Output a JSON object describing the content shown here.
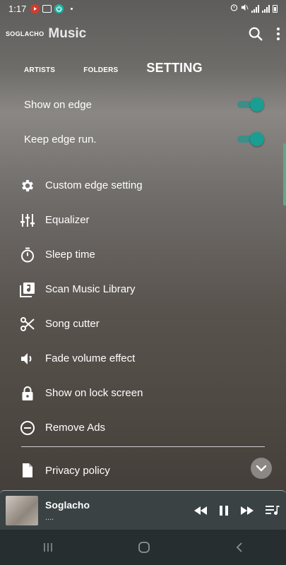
{
  "status": {
    "time": "1:17",
    "app_icons": [
      "youtube-icon",
      "gallery-icon",
      "power-icon"
    ],
    "colors": {
      "youtube": "#d33b2c",
      "gallery": "#ffffff",
      "power": "#1fb5a6"
    }
  },
  "header": {
    "brand_small": "SOGLACHO",
    "brand_big": "Music"
  },
  "tabs": [
    {
      "label": "ARTISTS",
      "active": false
    },
    {
      "label": "FOLDERS",
      "active": false
    },
    {
      "label": "SETTING",
      "active": true
    }
  ],
  "toggles": [
    {
      "label": "Show on edge",
      "on": true
    },
    {
      "label": "Keep edge run.",
      "on": true
    }
  ],
  "menu": [
    {
      "label": "Custom edge setting",
      "icon": "gear-icon"
    },
    {
      "label": "Equalizer",
      "icon": "equalizer-icon"
    },
    {
      "label": "Sleep time",
      "icon": "timer-icon"
    },
    {
      "label": "Scan Music Library",
      "icon": "music-library-icon"
    },
    {
      "label": "Song cutter",
      "icon": "scissors-icon"
    },
    {
      "label": "Fade volume effect",
      "icon": "volume-icon"
    },
    {
      "label": "Show on lock screen",
      "icon": "lock-icon"
    },
    {
      "label": "Remove Ads",
      "icon": "remove-icon"
    }
  ],
  "privacy": {
    "label": "Privacy policy",
    "icon": "document-icon"
  },
  "player": {
    "title": "Soglacho",
    "subtitle": "...."
  },
  "accent": "#1a9e91"
}
